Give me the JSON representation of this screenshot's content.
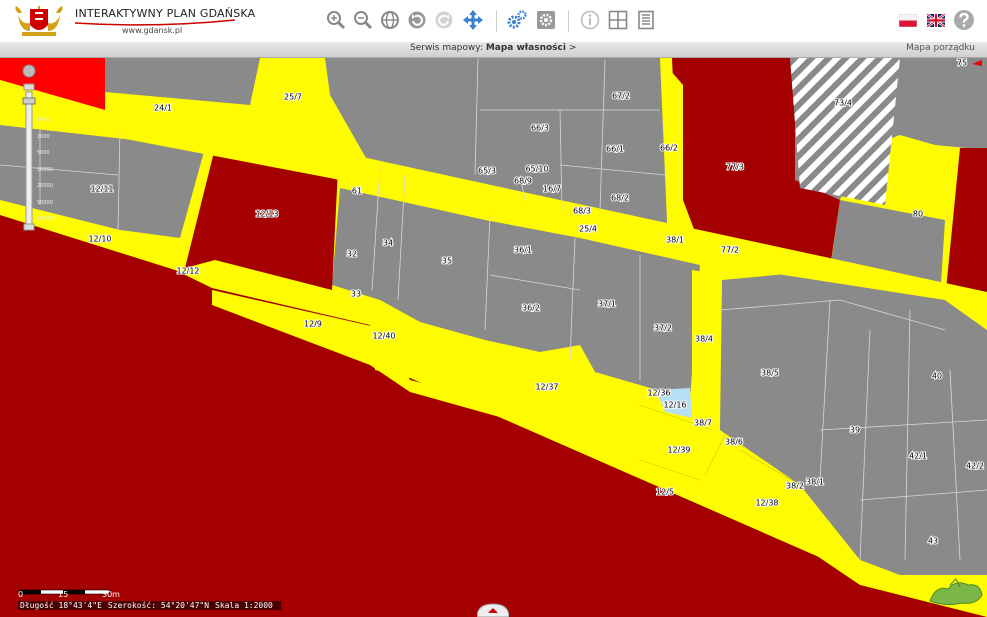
{
  "header": {
    "title": "INTERAKTYWNY PLAN GDAŃSKA",
    "url": "www.gdansk.pl"
  },
  "subbar": {
    "service_prefix": "Serwis mapowy:",
    "service_name": "Mapa własności",
    "service_suffix": ">",
    "right_label": "Mapa porządku"
  },
  "toolbar_icons": [
    "zoom-in-icon",
    "zoom-out-icon",
    "globe-icon",
    "undo-icon",
    "redo-icon",
    "pan-icon",
    "gears-icon",
    "settings-icon",
    "info-icon",
    "grid-icon",
    "list-icon",
    "poland-flag-icon",
    "uk-flag-icon",
    "help-icon"
  ],
  "colors": {
    "yellow": "#fffb00",
    "red": "#a50000",
    "bright_red": "#ff0000",
    "gray": "#8a8a8a",
    "light_blue": "#b8e0f5"
  },
  "zoom_labels": [
    "1000",
    "2000",
    "5000",
    "10000",
    "20000",
    "50000",
    "100000"
  ],
  "scale": {
    "labels": [
      "0",
      "15",
      "30m"
    ]
  },
  "coords": {
    "lon": "Długość  18°43'4\"E",
    "lat": "Szerokość: 54°20'47\"N",
    "scale": "Skala 1:2000"
  },
  "parcels": [
    "75",
    "24/1",
    "25/7",
    "67/2",
    "73/4",
    "66/3",
    "66/1",
    "66/2",
    "77/3",
    "12/11",
    "12/13",
    "65/10",
    "65/3",
    "68/9",
    "16/7",
    "61",
    "68/2",
    "68/3",
    "25/4",
    "80",
    "12/10",
    "34",
    "32",
    "35",
    "36/1",
    "38/1",
    "77/2",
    "12/12",
    "33",
    "36/2",
    "37/1",
    "12/9",
    "12/40",
    "37/2",
    "38/4",
    "38/5",
    "40",
    "12/37",
    "12/36",
    "12/16",
    "38/7",
    "39",
    "38/6",
    "12/39",
    "42/1",
    "42/2",
    "38/2",
    "38/1",
    "12/5",
    "12/38",
    "43"
  ]
}
